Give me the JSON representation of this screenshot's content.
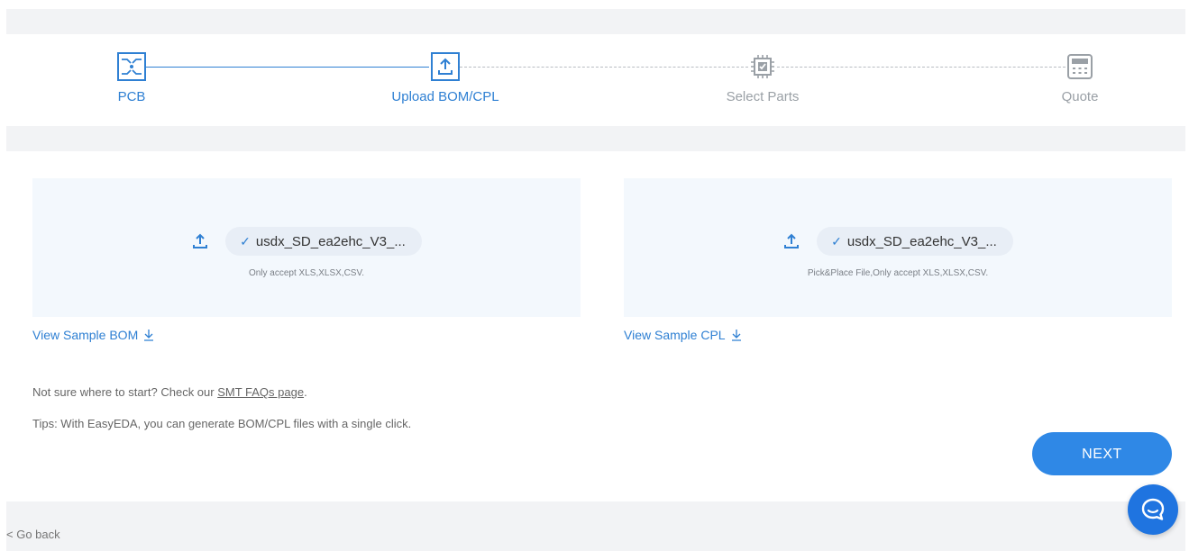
{
  "stepper": {
    "steps": [
      {
        "label": "PCB",
        "icon": "pcb-icon",
        "state": "done"
      },
      {
        "label": "Upload BOM/CPL",
        "icon": "upload-icon",
        "state": "active"
      },
      {
        "label": "Select Parts",
        "icon": "chip-icon",
        "state": "pending"
      },
      {
        "label": "Quote",
        "icon": "calculator-icon",
        "state": "pending"
      }
    ]
  },
  "bom": {
    "file_name": "usdx_SD_ea2ehc_V3_...",
    "hint": "Only accept XLS,XLSX,CSV.",
    "sample_link": "View Sample BOM"
  },
  "cpl": {
    "file_name": "usdx_SD_ea2ehc_V3_...",
    "hint": "Pick&Place File,Only accept XLS,XLSX,CSV.",
    "sample_link": "View Sample CPL"
  },
  "info": {
    "faq_prefix": "Not sure where to start? Check our ",
    "faq_link": "SMT FAQs page",
    "faq_suffix": ".",
    "tips": "Tips: With EasyEDA, you can generate BOM/CPL files with a single click."
  },
  "actions": {
    "next_label": "NEXT",
    "go_back_label": "< Go back"
  },
  "colors": {
    "accent": "#2f80d3",
    "button": "#2f88e6",
    "chat": "#1f74e0"
  }
}
